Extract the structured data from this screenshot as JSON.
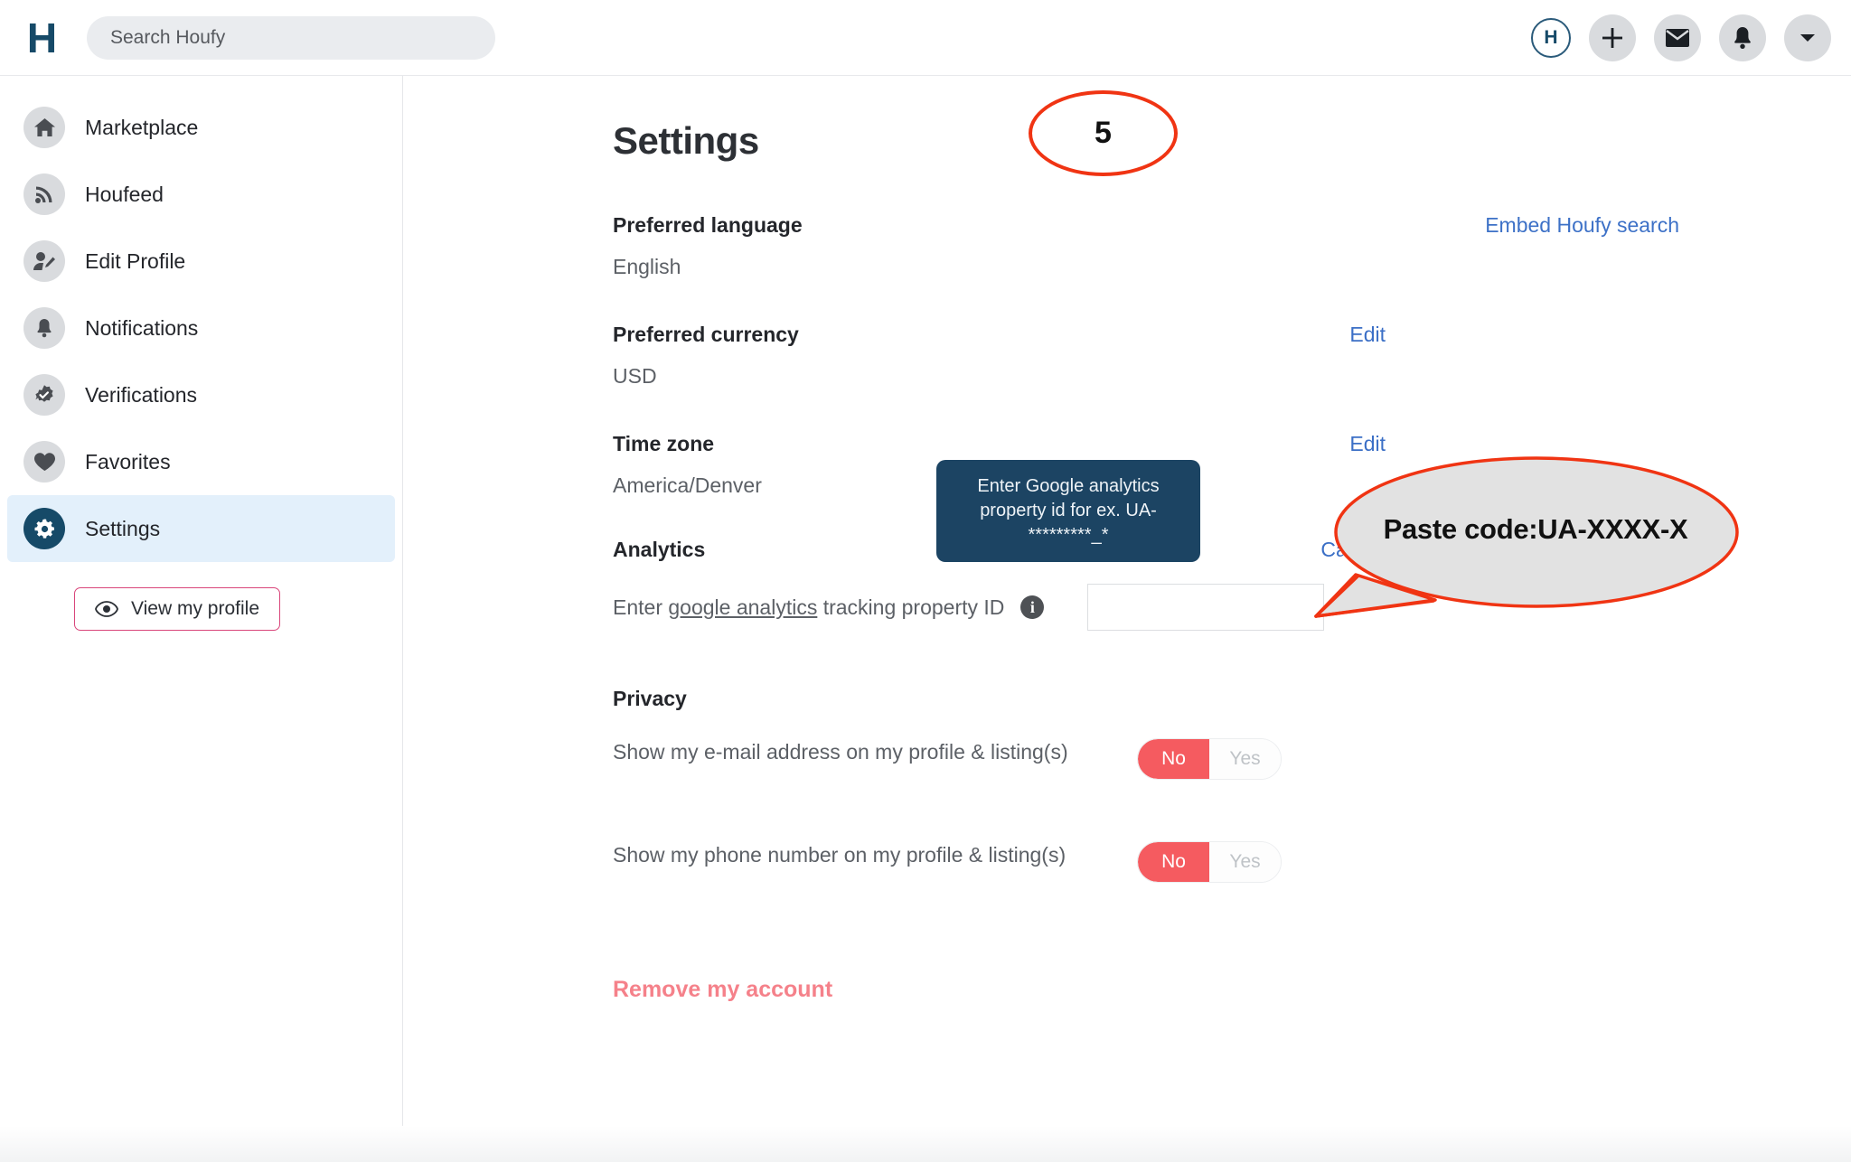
{
  "topbar": {
    "logo_letter": "H",
    "search": {
      "placeholder": "Search Houfy",
      "value": ""
    },
    "avatar_letter": "H",
    "buttons": [
      {
        "name": "add-button",
        "icon": "plus-icon"
      },
      {
        "name": "messages-button",
        "icon": "envelope-icon"
      },
      {
        "name": "notifications-button",
        "icon": "bell-icon"
      },
      {
        "name": "account-menu-button",
        "icon": "chevron-down-icon"
      }
    ]
  },
  "sidebar": {
    "items": [
      {
        "label": "Marketplace",
        "icon": "home-icon",
        "active": false
      },
      {
        "label": "Houfeed",
        "icon": "rss-icon",
        "active": false
      },
      {
        "label": "Edit Profile",
        "icon": "user-edit-icon",
        "active": false
      },
      {
        "label": "Notifications",
        "icon": "bell-icon",
        "active": false
      },
      {
        "label": "Verifications",
        "icon": "badge-check-icon",
        "active": false
      },
      {
        "label": "Favorites",
        "icon": "heart-icon",
        "active": false
      },
      {
        "label": "Settings",
        "icon": "gear-icon",
        "active": true
      }
    ],
    "view_profile_label": "View my profile",
    "view_profile_icon": "eye-icon"
  },
  "main": {
    "page_title": "Settings",
    "embed_link": "Embed Houfy search",
    "sections": {
      "language": {
        "title": "Preferred language",
        "value": "English"
      },
      "currency": {
        "title": "Preferred currency",
        "value": "USD",
        "action": "Edit"
      },
      "timezone": {
        "title": "Time zone",
        "value": "America/Denver",
        "action": "Edit"
      },
      "analytics": {
        "title": "Analytics",
        "action": "Cancel",
        "label_prefix": "Enter ",
        "label_link": "google analytics",
        "label_suffix": " tracking property ID",
        "info_icon": "info-icon",
        "input_value": "",
        "input_placeholder": "",
        "tooltip": "Enter Google analytics property id for ex. UA-*********_*"
      },
      "privacy": {
        "title": "Privacy",
        "rows": [
          {
            "text": "Show my e-mail address on my profile & listing(s)",
            "toggle": {
              "on_label": "No",
              "off_label": "Yes",
              "selected": "No"
            }
          },
          {
            "text": "Show my phone number on my profile & listing(s)",
            "toggle": {
              "on_label": "No",
              "off_label": "Yes",
              "selected": "No"
            }
          }
        ]
      }
    },
    "remove_account_label": "Remove my account"
  },
  "annotations": {
    "step_badge": "5",
    "callout_text": "Paste code:UA-XXXX-X"
  },
  "colors": {
    "brand_navy": "#164A68",
    "link_blue": "#3d71c7",
    "toggle_red": "#f55b60",
    "remove_red": "#f5818a",
    "annotation_red": "#f03413",
    "active_nav_bg": "#e3f0fb",
    "profile_btn_border": "#d9457a"
  }
}
